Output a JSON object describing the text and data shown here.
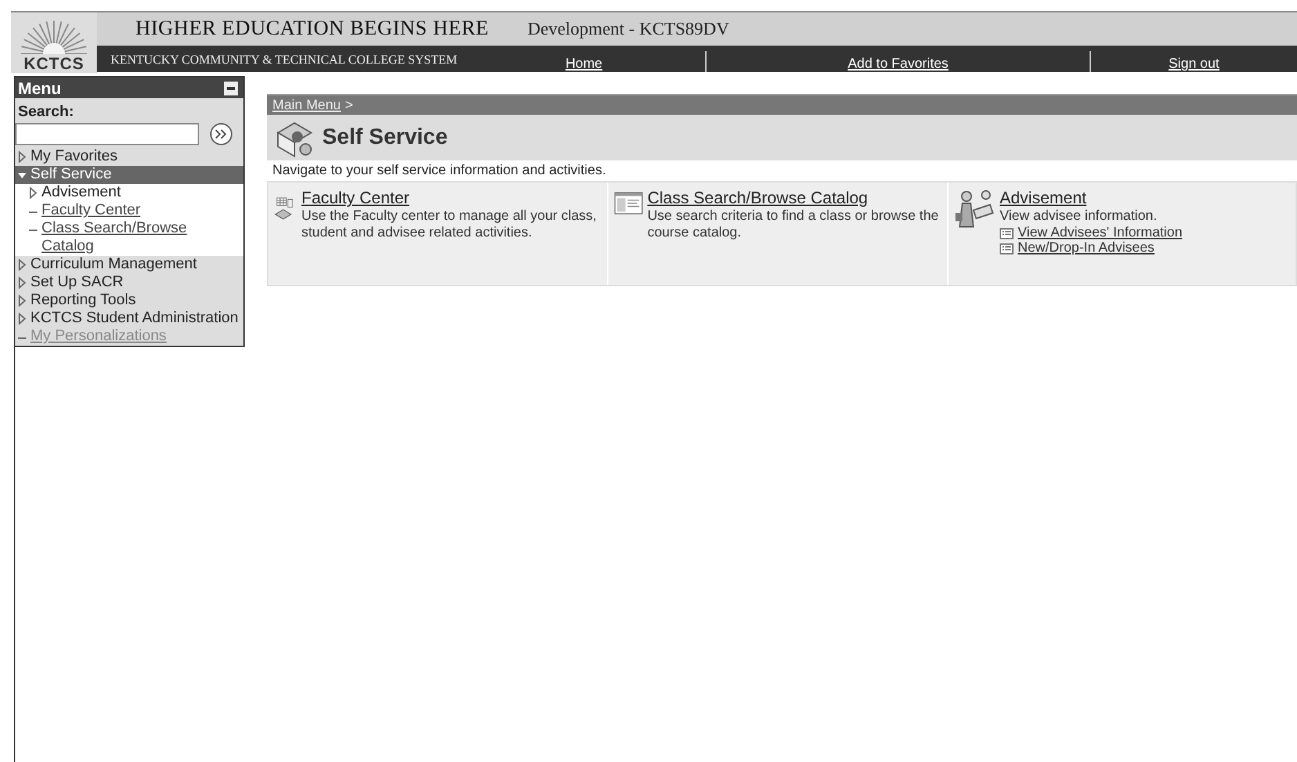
{
  "header": {
    "logo_text": "KCTCS",
    "title": "HIGHER EDUCATION BEGINS HERE",
    "environment": "Development - KCTS89DV",
    "subtitle": "KENTUCKY COMMUNITY & TECHNICAL COLLEGE SYSTEM",
    "nav": [
      "Home",
      "Add to Favorites",
      "Sign out"
    ]
  },
  "menu": {
    "title": "Menu",
    "search_label": "Search:",
    "items": [
      {
        "kind": "folder",
        "label": "My Favorites",
        "expanded": false,
        "selected": false
      },
      {
        "kind": "folder",
        "label": "Self Service",
        "expanded": true,
        "selected": true,
        "children": [
          {
            "kind": "folder",
            "label": "Advisement",
            "expanded": false,
            "selected": false
          },
          {
            "kind": "link",
            "label": "Faculty Center"
          },
          {
            "kind": "link",
            "label": "Class Search/Browse Catalog"
          }
        ]
      },
      {
        "kind": "folder",
        "label": "Curriculum Management",
        "expanded": false,
        "selected": false
      },
      {
        "kind": "folder",
        "label": "Set Up SACR",
        "expanded": false,
        "selected": false
      },
      {
        "kind": "folder",
        "label": "Reporting Tools",
        "expanded": false,
        "selected": false
      },
      {
        "kind": "folder",
        "label": "KCTCS Student Administration",
        "expanded": false,
        "selected": false
      },
      {
        "kind": "link",
        "label": "My Personalizations"
      }
    ]
  },
  "main": {
    "breadcrumb": "Main Menu",
    "breadcrumb_sep": ">",
    "title": "Self Service",
    "description": "Navigate to your self service information and activities.",
    "cards": [
      {
        "kind": "faculty",
        "title": "Faculty Center",
        "description": "Use the Faculty center to manage all your class, student and advisee related activities."
      },
      {
        "kind": "catalog",
        "title": "Class Search/Browse Catalog",
        "description": "Use search criteria to find a class or browse the course catalog."
      },
      {
        "kind": "advising",
        "title": "Advisement",
        "description": "View advisee information.",
        "links": [
          "View Advisees' Information",
          "New/Drop-In Advisees"
        ]
      }
    ]
  }
}
